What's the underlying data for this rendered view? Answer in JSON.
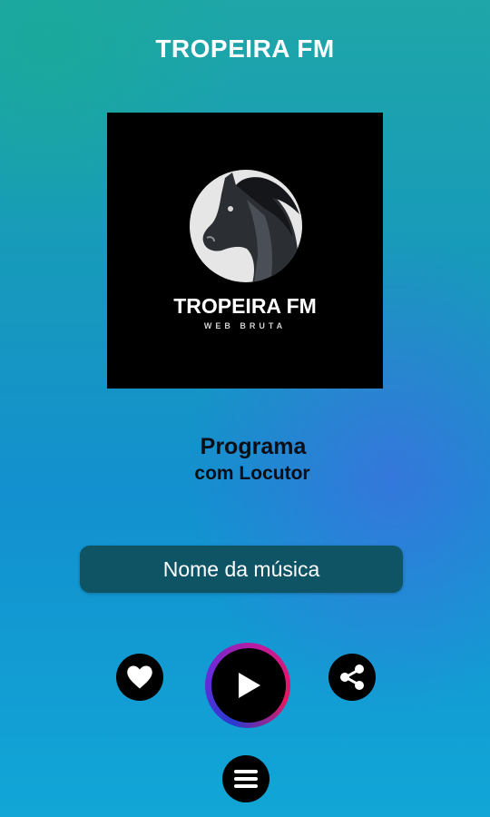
{
  "header": {
    "title": "TROPEIRA FM"
  },
  "cover": {
    "logo_title": "TROPEIRA FM",
    "logo_subtitle": "WEB BRUTA"
  },
  "program": {
    "title": "Programa",
    "subtitle": "com Locutor"
  },
  "song": {
    "name": "Nome da música"
  },
  "controls": {
    "like_icon": "heart-icon",
    "play_icon": "play-icon",
    "share_icon": "share-icon",
    "menu_icon": "menu-icon"
  },
  "colors": {
    "song_bar": "#0e5464",
    "button_bg": "#000000",
    "play_ring": [
      "#2a3bd0",
      "#6a2bd8",
      "#c21a9a",
      "#e8185f"
    ]
  }
}
